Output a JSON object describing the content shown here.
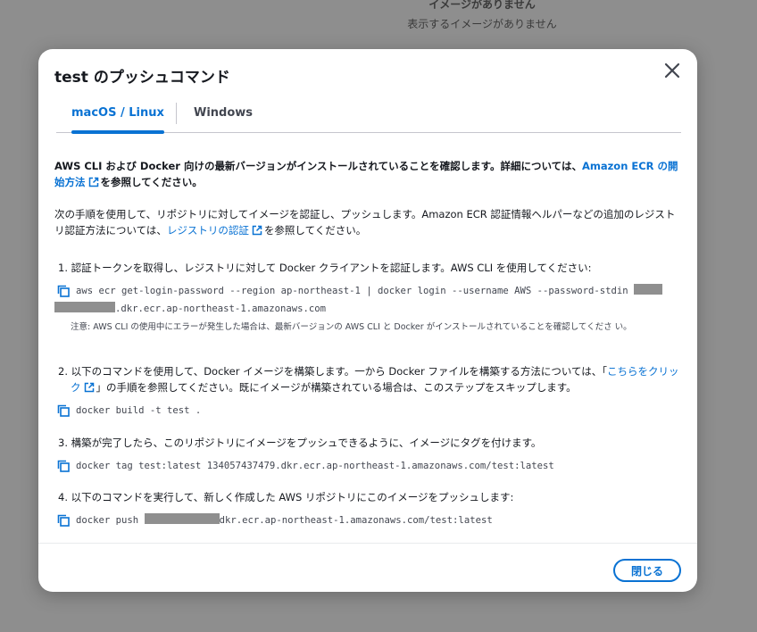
{
  "background": {
    "empty_title": "イメージがありません",
    "empty_subtitle": "表示するイメージがありません"
  },
  "modal": {
    "title": "test のプッシュコマンド",
    "close_icon": "close-icon",
    "tabs": [
      {
        "label": "macOS / Linux",
        "active": true
      },
      {
        "label": "Windows",
        "active": false
      }
    ],
    "intro": {
      "p1_text": "AWS CLI および Docker 向けの最新バージョンがインストールされていることを確認します。詳細については、",
      "p1_link": "Amazon ECR の開始方法",
      "p1_suffix": "を参照してください。",
      "p2_text": "次の手順を使用して、リポジトリに対してイメージを認証し、プッシュします。Amazon ECR 認証情報ヘルパーなどの追加のレジストリ認証方法については、",
      "p2_link": "レジストリの認証",
      "p2_suffix": "を参照してください。"
    },
    "steps": [
      {
        "text": "1. 認証トークンを取得し、レジストリに対して Docker クライアントを認証します。AWS CLI を使用してください:",
        "cmd_a": "aws ecr get-login-password --region ap-northeast-1 | docker login --username AWS --password-stdin",
        "cmd_b": ".dkr.ecr.ap-northeast-1.amazonaws.com",
        "note": "注意: AWS CLI の使用中にエラーが発生した場合は、最新バージョンの AWS CLI と Docker がインストールされていることを確認してくださ い。"
      },
      {
        "text_a": "2. 以下のコマンドを使用して、Docker イメージを構築します。一から Docker ファイルを構築する方法については、「",
        "link": "こちらをクリック",
        "text_b": "」の手順を参照してください。既にイメージが構築されている場合は、このステップをスキップします。",
        "cmd": "docker build -t test ."
      },
      {
        "text": "3. 構築が完了したら、このリポジトリにイメージをプッシュできるように、イメージにタグを付けます。",
        "cmd": "docker tag test:latest 134057437479.dkr.ecr.ap-northeast-1.amazonaws.com/test:latest"
      },
      {
        "text": "4. 以下のコマンドを実行して、新しく作成した AWS リポジトリにこのイメージをプッシュします:",
        "cmd_a": "docker push",
        "cmd_b": "dkr.ecr.ap-northeast-1.amazonaws.com/test:latest"
      }
    ],
    "copy_icon": "copy-icon",
    "external_link_icon": "external-link-icon",
    "close_button_label": "閉じる"
  },
  "colors": {
    "accent": "#0972d3",
    "text": "#16191f",
    "overlay": "#8e8e8e"
  }
}
